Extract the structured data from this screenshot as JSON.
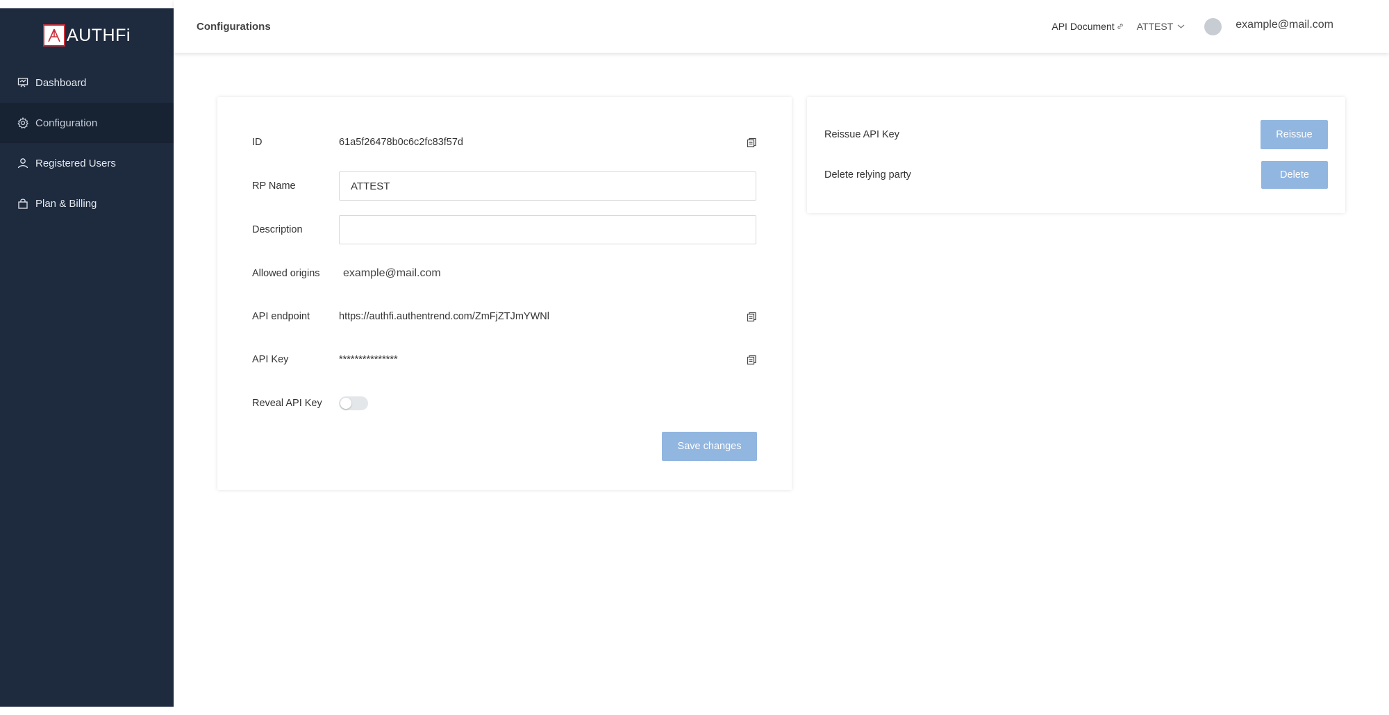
{
  "brand": {
    "logo_text": "AUTHFi",
    "accent": "#c8303a"
  },
  "sidebar": {
    "items": [
      {
        "label": "Dashboard",
        "icon": "dashboard-icon",
        "active": false
      },
      {
        "label": "Configuration",
        "icon": "gear-icon",
        "active": true
      },
      {
        "label": "Registered Users",
        "icon": "user-icon",
        "active": false
      },
      {
        "label": "Plan & Billing",
        "icon": "shopping-bag-icon",
        "active": false
      }
    ]
  },
  "header": {
    "title": "Configurations",
    "api_document": "API Document",
    "project": "ATTEST",
    "user_email": "example@mail.com"
  },
  "config": {
    "id_label": "ID",
    "id_value": "61a5f26478b0c6c2fc83f57d",
    "rp_name_label": "RP Name",
    "rp_name_value": "ATTEST",
    "description_label": "Description",
    "description_value": "",
    "allowed_origins_label": "Allowed origins",
    "allowed_origins_value": "example@mail.com",
    "api_endpoint_label": "API endpoint",
    "api_endpoint_value": "https://authfi.authentrend.com/ZmFjZTJmYWNl",
    "api_key_label": "API Key",
    "api_key_value": "***************",
    "reveal_label": "Reveal API Key",
    "reveal_enabled": false,
    "save_label": "Save changes"
  },
  "actions": {
    "reissue_label": "Reissue API Key",
    "reissue_button": "Reissue",
    "delete_label": "Delete relying party",
    "delete_button": "Delete",
    "button_color": "#91b6e0"
  }
}
